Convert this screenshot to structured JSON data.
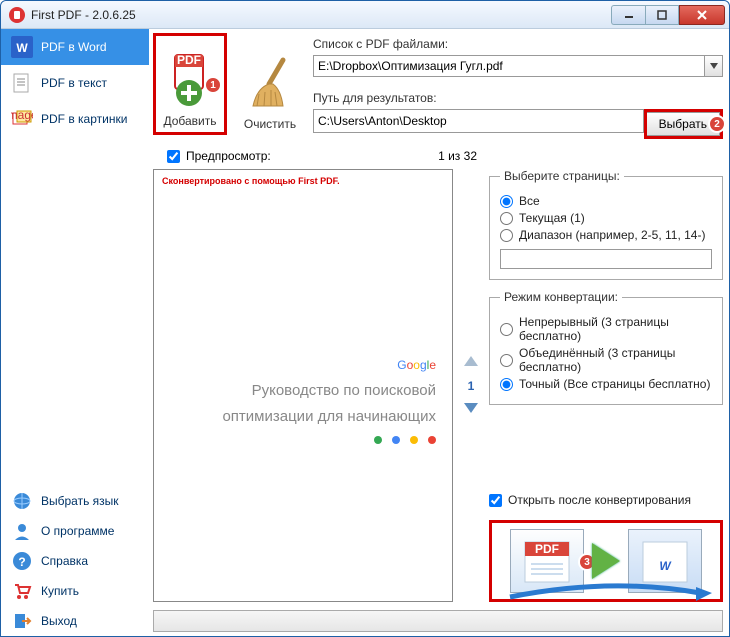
{
  "window": {
    "title": "First PDF - 2.0.6.25"
  },
  "sidebar": {
    "top": [
      {
        "label": "PDF в Word"
      },
      {
        "label": "PDF в текст"
      },
      {
        "label": "PDF в картинки"
      }
    ],
    "bottom": [
      {
        "label": "Выбрать язык"
      },
      {
        "label": "О программе"
      },
      {
        "label": "Справка"
      },
      {
        "label": "Купить"
      },
      {
        "label": "Выход"
      }
    ]
  },
  "toolbar": {
    "add_label": "Добавить",
    "clear_label": "Очистить"
  },
  "paths": {
    "source_label": "Список с PDF файлами:",
    "source_value": "E:\\Dropbox\\Оптимизация Гугл.pdf",
    "dest_label": "Путь для результатов:",
    "dest_value": "C:\\Users\\Anton\\Desktop",
    "browse_label": "Выбрать"
  },
  "preview": {
    "checkbox_label": "Предпросмотр:",
    "page_counter": "1 из 32",
    "watermark": "Сконвертировано с помощью First PDF.",
    "doc_line1": "Руководство по поисковой",
    "doc_line2": "оптимизации для начинающих",
    "current_page": "1"
  },
  "pages_group": {
    "legend": "Выберите страницы:",
    "all": "Все",
    "current": "Текущая (1)",
    "range": "Диапазон (например, 2-5, 11, 14-)",
    "range_value": ""
  },
  "mode_group": {
    "legend": "Режим конвертации:",
    "continuous": "Непрерывный (3 страницы бесплатно)",
    "merged": "Объединённый (3 страницы бесплатно)",
    "exact": "Точный (Все страницы бесплатно)"
  },
  "footer": {
    "open_after": "Открыть после конвертирования",
    "pdf_tag": "PDF"
  },
  "badges": {
    "one": "1",
    "two": "2",
    "three": "3"
  }
}
